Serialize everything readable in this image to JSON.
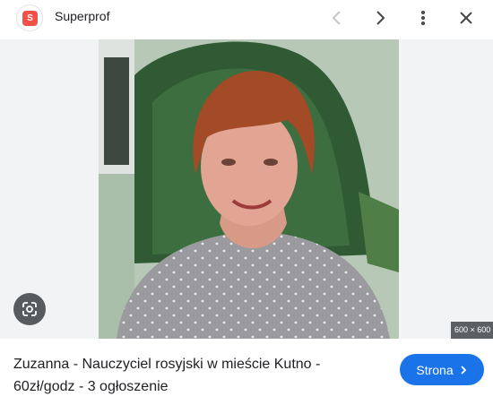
{
  "header": {
    "site_name": "Superprof",
    "logo_letter": "S",
    "logo_color": "#f0524a",
    "icons": [
      "chevron-left-icon",
      "chevron-right-icon",
      "more-vert-icon",
      "close-icon"
    ]
  },
  "image": {
    "dimensions_label": "600 × 600",
    "lens_icon": "google-lens-icon"
  },
  "result": {
    "caption": "Zuzanna - Nauczyciel rosyjski w mieście Kutno - 60zł/godz - 3 ogłoszenie",
    "visit_label": "Strona",
    "visit_color": "#1a73e8"
  }
}
